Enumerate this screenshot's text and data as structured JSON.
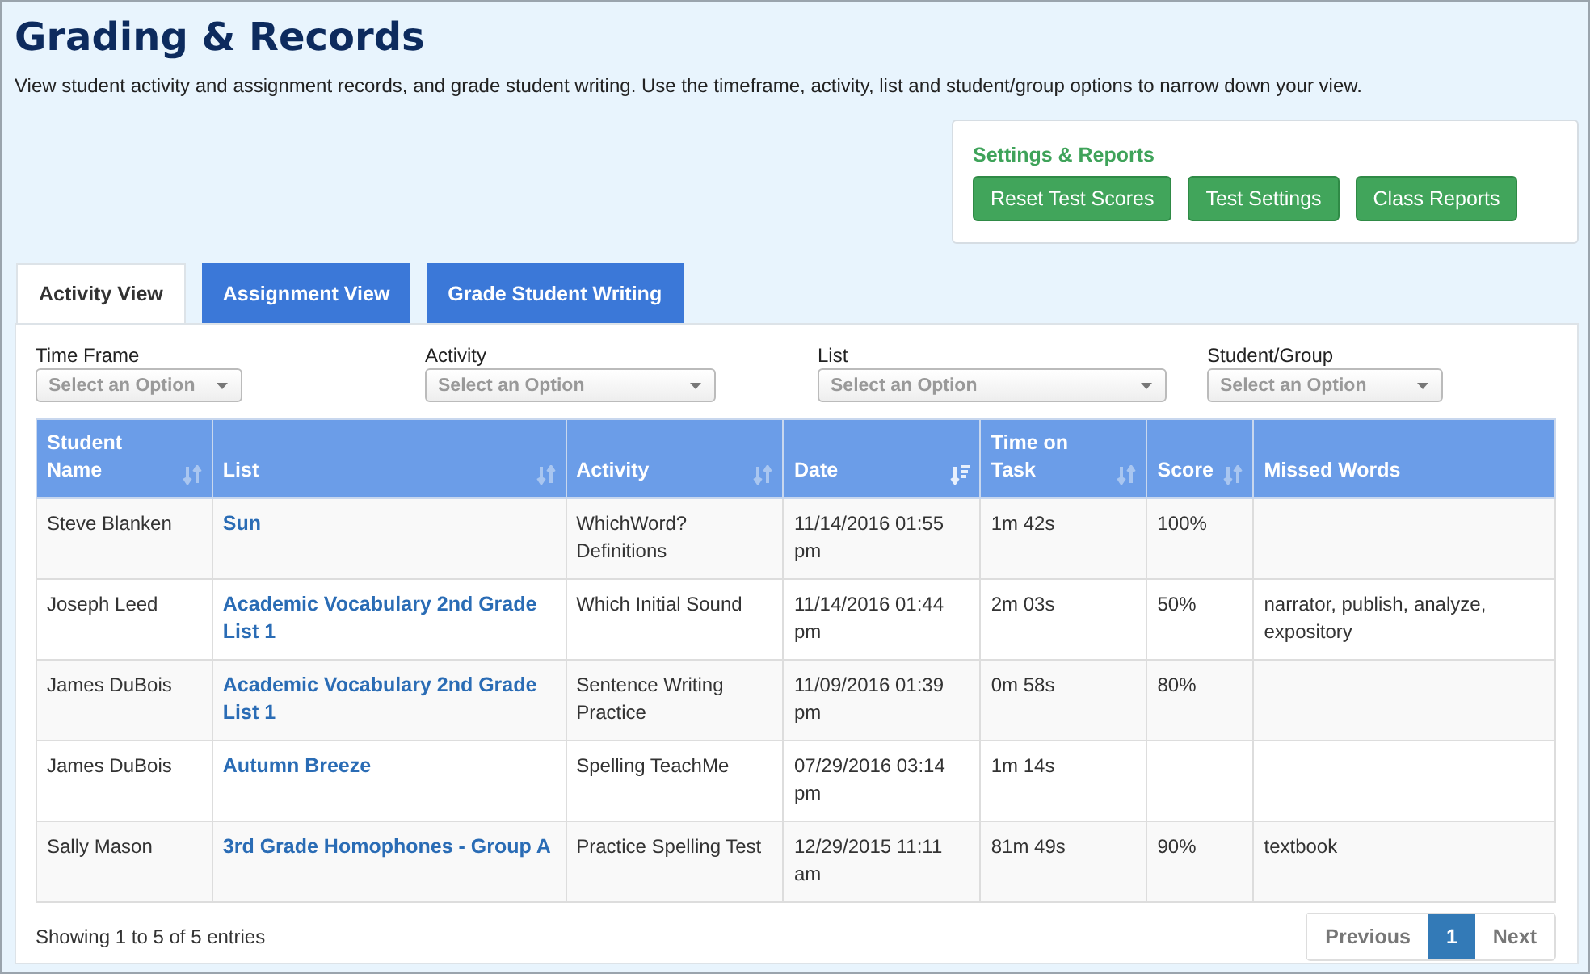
{
  "title": "Grading & Records",
  "description": "View student activity and assignment records, and grade student writing. Use the timeframe, activity, list and student/group options to narrow down your view.",
  "settings_panel": {
    "title": "Settings & Reports",
    "buttons": [
      "Reset Test Scores",
      "Test Settings",
      "Class Reports"
    ]
  },
  "tabs": [
    {
      "label": "Activity View",
      "selected": true
    },
    {
      "label": "Assignment View",
      "selected": false
    },
    {
      "label": "Grade Student Writing",
      "selected": false
    }
  ],
  "filters": [
    {
      "label": "Time Frame",
      "placeholder": "Select an Option"
    },
    {
      "label": "Activity",
      "placeholder": "Select an Option"
    },
    {
      "label": "List",
      "placeholder": "Select an Option"
    },
    {
      "label": "Student/Group",
      "placeholder": "Select an Option"
    }
  ],
  "table": {
    "columns": [
      {
        "label": "Student Name",
        "kind": "sortable",
        "sorted": false
      },
      {
        "label": "List",
        "kind": "sortable",
        "sorted": false
      },
      {
        "label": "Activity",
        "kind": "sortable",
        "sorted": false
      },
      {
        "label": "Date",
        "kind": "sortable",
        "sorted": true
      },
      {
        "label": "Time on Task",
        "kind": "sortable",
        "sorted": false
      },
      {
        "label": "Score",
        "kind": "sortable",
        "sorted": false
      },
      {
        "label": "Missed Words",
        "kind": "plain"
      }
    ],
    "rows": [
      [
        "Steve Blanken",
        "Sun",
        "WhichWord? Definitions",
        "11/14/2016 01:55 pm",
        "1m 42s",
        "100%",
        ""
      ],
      [
        "Joseph Leed",
        "Academic Vocabulary 2nd Grade List 1",
        "Which Initial Sound",
        "11/14/2016 01:44 pm",
        "2m 03s",
        "50%",
        "narrator, publish, analyze, expository"
      ],
      [
        "James DuBois",
        "Academic Vocabulary 2nd Grade List 1",
        "Sentence Writing Practice",
        "11/09/2016 01:39 pm",
        "0m 58s",
        "80%",
        ""
      ],
      [
        "James DuBois",
        "Autumn Breeze",
        "Spelling TeachMe",
        "07/29/2016 03:14 pm",
        "1m 14s",
        "",
        ""
      ],
      [
        "Sally Mason",
        "3rd Grade Homophones - Group A",
        "Practice Spelling Test",
        "12/29/2015 11:11 am",
        "81m 49s",
        "90%",
        "textbook"
      ]
    ]
  },
  "footer": {
    "info": "Showing 1 to 5 of 5 entries",
    "pagination": [
      {
        "label": "Previous",
        "selected": false
      },
      {
        "label": "1",
        "selected": true
      },
      {
        "label": "Next",
        "selected": false
      }
    ]
  }
}
